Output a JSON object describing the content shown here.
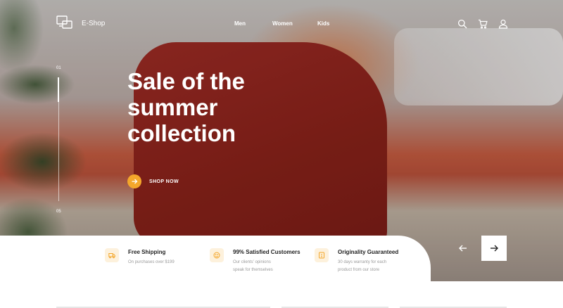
{
  "brand": {
    "name": "E-Shop",
    "logo_icon": "logo-devices-icon"
  },
  "nav": {
    "items": [
      {
        "label": "Men"
      },
      {
        "label": "Women"
      },
      {
        "label": "Kids"
      }
    ]
  },
  "header_icons": [
    "search-icon",
    "cart-icon",
    "user-icon"
  ],
  "hero": {
    "headline": [
      "Sale of the",
      "summer",
      "collection"
    ],
    "cta_label": "SHOP NOW",
    "slide_current": "01",
    "slide_total": "05",
    "slide_progress": 0.2
  },
  "features": [
    {
      "title": "Free Shipping",
      "desc": [
        "On purchases over $199"
      ],
      "icon": "shipping-icon"
    },
    {
      "title": "99% Satisfied Customers",
      "desc": [
        "Our clients' opinions",
        "speak for themselves"
      ],
      "icon": "smile-icon"
    },
    {
      "title": "Originality Guaranteed",
      "desc": [
        "30 days warranty for each",
        "product from our store"
      ],
      "icon": "certificate-icon"
    }
  ],
  "colors": {
    "accent": "#f4a72b",
    "feature_icon_bg": "#fdf1dc",
    "text_dark": "#222222",
    "text_muted": "#999999"
  }
}
